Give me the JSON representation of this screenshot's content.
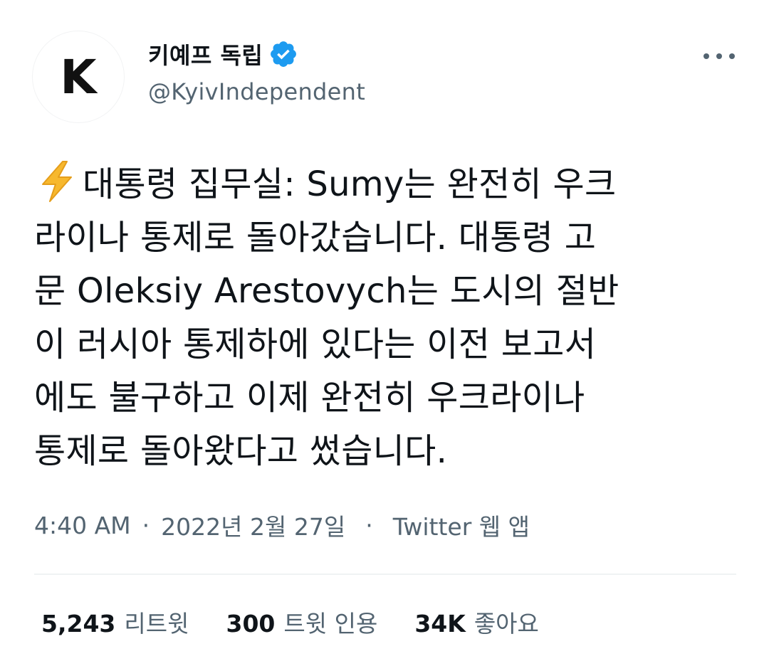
{
  "author": {
    "avatar_letter": "K",
    "display_name": "키예프 독립",
    "handle": "@KyivIndependent",
    "verified_icon": "verified-badge-icon",
    "verified_color": "#1d9bf0"
  },
  "more_icon": "more-horizontal-icon",
  "tweet": {
    "emoji": "high-voltage-emoji",
    "lines": [
      "대통령 집무실: Sumy는 완전히 우크",
      "라이나 통제로 돌아갔습니다. 대통령 고",
      "문 Oleksiy Arestovych는 도시의 절반",
      "이 러시아 통제하에 있다는 이전 보고서",
      "에도 불구하고 이제 완전히 우크라이나",
      "통제로 돌아왔다고 썼습니다."
    ]
  },
  "meta": {
    "time": "4:40 AM",
    "separator": "·",
    "date": "2022년 2월 27일",
    "source": "Twitter 웹 앱"
  },
  "stats": {
    "retweets": {
      "value": "5,243",
      "label": "리트윗"
    },
    "quotes": {
      "value": "300",
      "label": "트윗 인용"
    },
    "likes": {
      "value": "34K",
      "label": "좋아요"
    }
  },
  "colors": {
    "text_primary": "#0f1419",
    "text_secondary": "#536471",
    "divider": "#eff3f4",
    "bolt": "#f7b82e"
  }
}
